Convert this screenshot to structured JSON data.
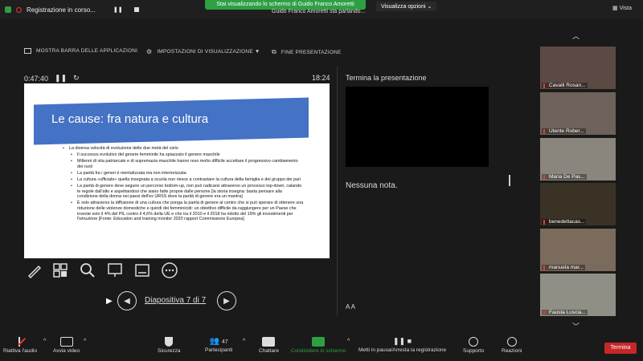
{
  "topbar": {
    "recording_label": "Registrazione in corso...",
    "share_banner": "Stai visualizzando lo schermo di Guido Franco Amoretti",
    "speaking": "Guido Franco Amoretti sta parlando...",
    "view_options": "Visualizza opzioni",
    "view_label": "Vista"
  },
  "presenter_toolbar": {
    "taskbar": "MOSTRA BARRA DELLE APPLICAZIONI",
    "display_settings": "IMPOSTAZIONI DI VISUALIZZAZIONE ▼",
    "end_show": "FINE PRESENTAZIONE"
  },
  "timer": {
    "elapsed": "0:47:40",
    "clock": "18:24"
  },
  "slide": {
    "title": "Le cause: fra natura e cultura",
    "main_bullet": "La diversa velocità di evoluzione delle due metà del cielo",
    "bullets": [
      "Il successo evolutivo del genere femminile ha spiazzato il genere maschile",
      "Millenni di vita patriarcale e di supremazia maschile hanno reso molto difficile accettare il progressivo cambiamento dei ruoli",
      "La parità fra i generi è mentalizzata ma non interiorizzata",
      "La cultura «ufficiale» quella insegnata a scuola non riesce a contrastare la cultura della famiglia e del gruppo dei pari",
      "La parità di genere deve seguire un percorso bottom-up, non può radicarsi attraverso un processo top-down, calando le regole dall'alto e aspettandosi che siano fatte proprie dalle persone [la storia insegna: basta pensare alla condizione della donna nei paesi dell'ex URSS dove la parità di genere era un mantra]",
      "È solo attraverso la diffusione di una cultura che ponga la parità di genere al centro che si può sperare di ottenere una riduzione delle violenze domestiche e quindi dei femminicidi: un obiettivo difficile da raggiungere per un Paese che investe solo il 4% del PIL contro il 4,6% della UE e che tra il 2010 e il 2018 ha ridotto del 19% gli investimenti per l'istruzione [Fonte: Education and training monitor 2020 rapport Commissione Europea]"
    ]
  },
  "slide_nav": {
    "counter": "Diapositiva 7 di 7"
  },
  "right_panel": {
    "end_presentation": "Termina la presentazione",
    "notes": "Nessuna nota.",
    "font_a": "A A"
  },
  "participants": [
    {
      "name": "Cavalli Rosan..."
    },
    {
      "name": "Utente Rober..."
    },
    {
      "name": "Maria De Pas..."
    },
    {
      "name": "benedettacas..."
    },
    {
      "name": "manuela mar..."
    },
    {
      "name": "Fausta Luscia..."
    }
  ],
  "bottombar": {
    "unmute": "Riattiva l'audio",
    "video": "Avvia video",
    "security": "Sicurezza",
    "participants": "Partecipanti",
    "participants_count": "47",
    "chat": "Chattare",
    "share": "Condividere lo schermo",
    "pause": "Metti in pausa/Arresta la registrazione",
    "support": "Supporto",
    "reactions": "Reazioni",
    "end": "Termina"
  },
  "colors": {
    "slide_title_bg": "#4472c4",
    "share_green": "#2ea043",
    "end_red": "#c62828"
  }
}
